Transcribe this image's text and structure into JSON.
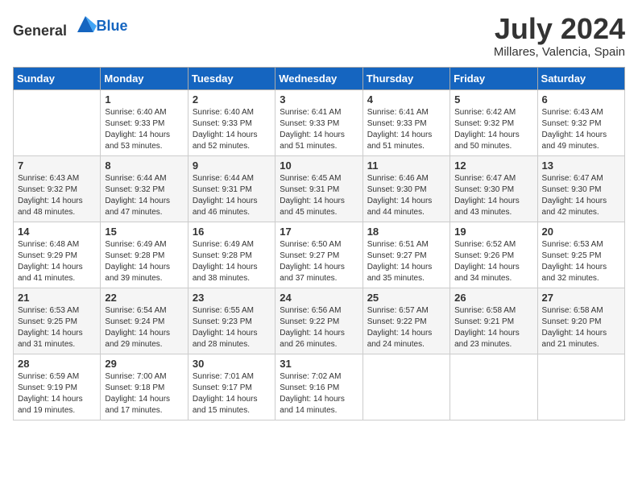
{
  "header": {
    "logo_general": "General",
    "logo_blue": "Blue",
    "month_year": "July 2024",
    "location": "Millares, Valencia, Spain"
  },
  "days_of_week": [
    "Sunday",
    "Monday",
    "Tuesday",
    "Wednesday",
    "Thursday",
    "Friday",
    "Saturday"
  ],
  "weeks": [
    [
      {
        "day": "",
        "info": ""
      },
      {
        "day": "1",
        "info": "Sunrise: 6:40 AM\nSunset: 9:33 PM\nDaylight: 14 hours\nand 53 minutes."
      },
      {
        "day": "2",
        "info": "Sunrise: 6:40 AM\nSunset: 9:33 PM\nDaylight: 14 hours\nand 52 minutes."
      },
      {
        "day": "3",
        "info": "Sunrise: 6:41 AM\nSunset: 9:33 PM\nDaylight: 14 hours\nand 51 minutes."
      },
      {
        "day": "4",
        "info": "Sunrise: 6:41 AM\nSunset: 9:33 PM\nDaylight: 14 hours\nand 51 minutes."
      },
      {
        "day": "5",
        "info": "Sunrise: 6:42 AM\nSunset: 9:32 PM\nDaylight: 14 hours\nand 50 minutes."
      },
      {
        "day": "6",
        "info": "Sunrise: 6:43 AM\nSunset: 9:32 PM\nDaylight: 14 hours\nand 49 minutes."
      }
    ],
    [
      {
        "day": "7",
        "info": "Sunrise: 6:43 AM\nSunset: 9:32 PM\nDaylight: 14 hours\nand 48 minutes."
      },
      {
        "day": "8",
        "info": "Sunrise: 6:44 AM\nSunset: 9:32 PM\nDaylight: 14 hours\nand 47 minutes."
      },
      {
        "day": "9",
        "info": "Sunrise: 6:44 AM\nSunset: 9:31 PM\nDaylight: 14 hours\nand 46 minutes."
      },
      {
        "day": "10",
        "info": "Sunrise: 6:45 AM\nSunset: 9:31 PM\nDaylight: 14 hours\nand 45 minutes."
      },
      {
        "day": "11",
        "info": "Sunrise: 6:46 AM\nSunset: 9:30 PM\nDaylight: 14 hours\nand 44 minutes."
      },
      {
        "day": "12",
        "info": "Sunrise: 6:47 AM\nSunset: 9:30 PM\nDaylight: 14 hours\nand 43 minutes."
      },
      {
        "day": "13",
        "info": "Sunrise: 6:47 AM\nSunset: 9:30 PM\nDaylight: 14 hours\nand 42 minutes."
      }
    ],
    [
      {
        "day": "14",
        "info": "Sunrise: 6:48 AM\nSunset: 9:29 PM\nDaylight: 14 hours\nand 41 minutes."
      },
      {
        "day": "15",
        "info": "Sunrise: 6:49 AM\nSunset: 9:28 PM\nDaylight: 14 hours\nand 39 minutes."
      },
      {
        "day": "16",
        "info": "Sunrise: 6:49 AM\nSunset: 9:28 PM\nDaylight: 14 hours\nand 38 minutes."
      },
      {
        "day": "17",
        "info": "Sunrise: 6:50 AM\nSunset: 9:27 PM\nDaylight: 14 hours\nand 37 minutes."
      },
      {
        "day": "18",
        "info": "Sunrise: 6:51 AM\nSunset: 9:27 PM\nDaylight: 14 hours\nand 35 minutes."
      },
      {
        "day": "19",
        "info": "Sunrise: 6:52 AM\nSunset: 9:26 PM\nDaylight: 14 hours\nand 34 minutes."
      },
      {
        "day": "20",
        "info": "Sunrise: 6:53 AM\nSunset: 9:25 PM\nDaylight: 14 hours\nand 32 minutes."
      }
    ],
    [
      {
        "day": "21",
        "info": "Sunrise: 6:53 AM\nSunset: 9:25 PM\nDaylight: 14 hours\nand 31 minutes."
      },
      {
        "day": "22",
        "info": "Sunrise: 6:54 AM\nSunset: 9:24 PM\nDaylight: 14 hours\nand 29 minutes."
      },
      {
        "day": "23",
        "info": "Sunrise: 6:55 AM\nSunset: 9:23 PM\nDaylight: 14 hours\nand 28 minutes."
      },
      {
        "day": "24",
        "info": "Sunrise: 6:56 AM\nSunset: 9:22 PM\nDaylight: 14 hours\nand 26 minutes."
      },
      {
        "day": "25",
        "info": "Sunrise: 6:57 AM\nSunset: 9:22 PM\nDaylight: 14 hours\nand 24 minutes."
      },
      {
        "day": "26",
        "info": "Sunrise: 6:58 AM\nSunset: 9:21 PM\nDaylight: 14 hours\nand 23 minutes."
      },
      {
        "day": "27",
        "info": "Sunrise: 6:58 AM\nSunset: 9:20 PM\nDaylight: 14 hours\nand 21 minutes."
      }
    ],
    [
      {
        "day": "28",
        "info": "Sunrise: 6:59 AM\nSunset: 9:19 PM\nDaylight: 14 hours\nand 19 minutes."
      },
      {
        "day": "29",
        "info": "Sunrise: 7:00 AM\nSunset: 9:18 PM\nDaylight: 14 hours\nand 17 minutes."
      },
      {
        "day": "30",
        "info": "Sunrise: 7:01 AM\nSunset: 9:17 PM\nDaylight: 14 hours\nand 15 minutes."
      },
      {
        "day": "31",
        "info": "Sunrise: 7:02 AM\nSunset: 9:16 PM\nDaylight: 14 hours\nand 14 minutes."
      },
      {
        "day": "",
        "info": ""
      },
      {
        "day": "",
        "info": ""
      },
      {
        "day": "",
        "info": ""
      }
    ]
  ]
}
